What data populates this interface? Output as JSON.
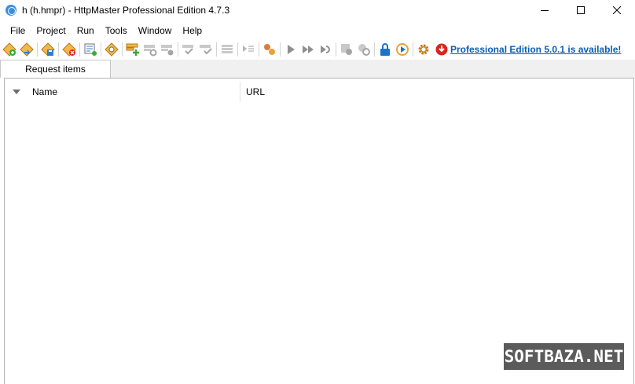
{
  "window": {
    "title": "h (h.hmpr) - HttpMaster Professional Edition 4.7.3"
  },
  "menu": {
    "items": [
      "File",
      "Project",
      "Run",
      "Tools",
      "Window",
      "Help"
    ]
  },
  "toolbar": {
    "update_notice": "Professional Edition 5.0.1 is available!",
    "colors": {
      "accent_orange": "#e8a23a",
      "accent_blue": "#0a5db5",
      "disabled_gray": "#b3b3b3",
      "update_red": "#d8261c"
    }
  },
  "tabs": [
    {
      "label": "Request items"
    }
  ],
  "list": {
    "columns": [
      {
        "label": "Name"
      },
      {
        "label": "URL"
      }
    ]
  },
  "watermark": {
    "text": "SOFTBAZA.NET"
  }
}
